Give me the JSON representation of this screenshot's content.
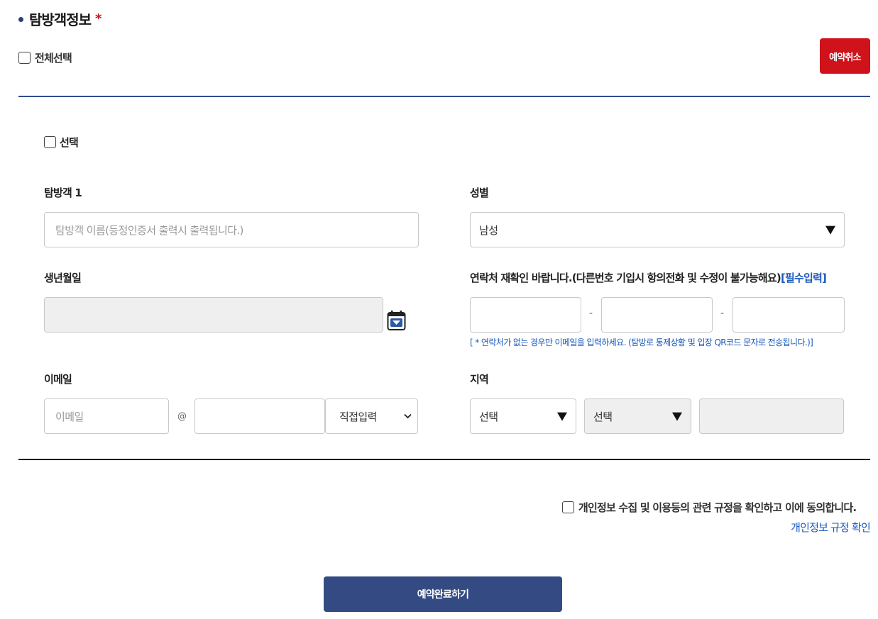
{
  "section": {
    "title": "탐방객정보",
    "required_mark": "*"
  },
  "select_all_label": "전체선택",
  "cancel_button_label": "예약취소",
  "visitor": {
    "select_label": "선택",
    "name_label": "탐방객 1",
    "name_placeholder": "탐방객 이름(등정인증서 출력시 출력됩니다.)",
    "gender_label": "성별",
    "gender_value": "남성",
    "birth_label": "생년월일",
    "birth_value": "",
    "phone_label": "연락처 재확인 바랍니다.(다른번호 기입시 항의전화 및 수정이 불가능해요)",
    "phone_required": "[필수입력]",
    "phone_separator": "-",
    "phone_note": "[ * 연락처가 없는 경우만 이메일을 입력하세요. (탐방로 통제상황 및 입장 QR코드 문자로 전송됩니다.)]",
    "email_label": "이메일",
    "email_placeholder": "이메일",
    "email_at": "@",
    "email_domain_select": "직접입력",
    "region_label": "지역",
    "region_select_1": "선택",
    "region_select_2": "선택"
  },
  "agreement": {
    "text": "개인정보 수집 및 이용등의 관련 규정을 확인하고 이에 동의합니다.",
    "link": "개인정보 규정 확인"
  },
  "submit_button_label": "예약완료하기",
  "colors": {
    "accent_blue": "#334b82",
    "cancel_red": "#d0121b",
    "link_blue": "#1a5bbd"
  }
}
